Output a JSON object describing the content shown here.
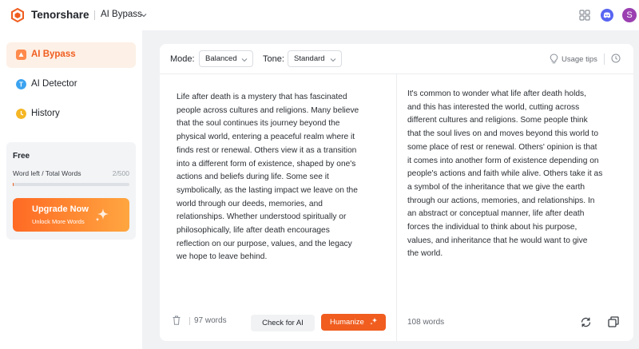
{
  "header": {
    "brand": "Tenorshare",
    "product": "AI Bypass",
    "icons": [
      "tenorshare-logo-icon",
      "apps-grid-icon",
      "discord-icon"
    ],
    "avatar_letter": "S"
  },
  "sidebar": {
    "items": [
      {
        "label": "AI Bypass",
        "icon": "ai-bypass-icon",
        "active": true
      },
      {
        "label": "AI Detector",
        "icon": "ai-detector-icon",
        "active": false
      },
      {
        "label": "History",
        "icon": "history-icon",
        "active": false
      }
    ],
    "plan": {
      "name": "Free",
      "words_label": "Word left / Total Words",
      "words_count": "2/500",
      "used_fraction": 0.004
    },
    "upgrade": {
      "title": "Upgrade Now",
      "subtitle": "Unlock More Words"
    }
  },
  "toolbar": {
    "mode_label": "Mode:",
    "mode_value": "Balanced",
    "tone_label": "Tone:",
    "tone_value": "Standard",
    "tips_label": "Usage tips"
  },
  "input": {
    "lines": [
      "Life after death is a mystery that has fascinated",
      "people across cultures and religions. Many believe",
      "that the soul continues its journey beyond the",
      "physical world, entering a peaceful realm where it",
      "finds rest or renewal. Others view it as a transition",
      "into a different form of existence, shaped by one's",
      "actions and beliefs during life. Some see it",
      "symbolically, as the lasting impact we leave on the",
      "world through our deeds, memories, and",
      "relationships. Whether understood spiritually or",
      "philosophically, life after death encourages",
      "reflection on our purpose, values, and the legacy",
      "we hope to leave behind."
    ],
    "word_count": "97 words",
    "check_label": "Check for AI",
    "humanize_label": "Humanize"
  },
  "output": {
    "lines": [
      "It's common to wonder what life after death holds,",
      "and this has interested the world, cutting across",
      "different cultures and religions. Some people think",
      "that the soul lives on and moves beyond this world to",
      "some place of rest or renewal. Others' opinion is that",
      "it comes into another form of existence depending on",
      "people's actions and faith while alive. Others take it as",
      "a symbol of the inheritance that we give the earth",
      "through our actions, memories, and relationships. In",
      "an abstract or conceptual manner, life after death",
      "forces the individual to think about his purpose,",
      "values, and inheritance that he would want to give",
      "the world."
    ],
    "word_count": "108 words"
  },
  "colors": {
    "accent": "#f05d1f",
    "accent_light": "#fdf0e6",
    "upgrade_gradient": [
      "#ff6a24",
      "#ffa640"
    ],
    "discord": "#5865f2",
    "avatar": "#9b3fb1"
  }
}
